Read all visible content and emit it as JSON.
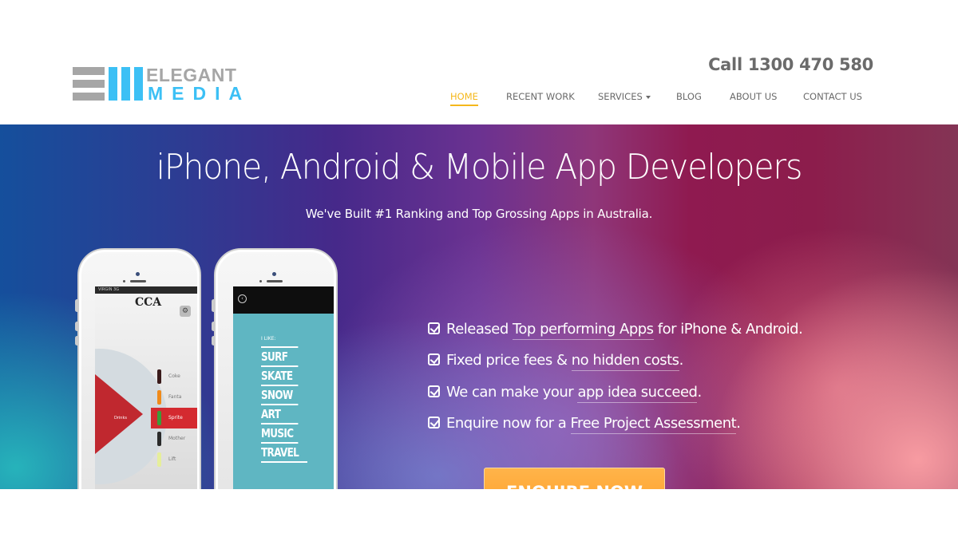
{
  "header": {
    "logo": {
      "top": "ELEGANT",
      "bottom": "MEDIA"
    },
    "phone_cta": "Call 1300 470 580",
    "nav": [
      {
        "label": "HOME",
        "active": true
      },
      {
        "label": "RECENT WORK"
      },
      {
        "label": "SERVICES",
        "has_dropdown": true
      },
      {
        "label": "BLOG"
      },
      {
        "label": "ABOUT US"
      },
      {
        "label": "CONTACT US"
      }
    ]
  },
  "hero": {
    "title": "iPhone, Android & Mobile App Developers",
    "subtitle": "We've Built #1 Ranking and Top Grossing Apps in Australia.",
    "phone1": {
      "carrier": "VIRGIN 3G",
      "logo": "CCA",
      "wedge_label": "Drinks",
      "drinks": [
        "Coke",
        "Fanta",
        "Sprite",
        "Mother",
        "Lift"
      ],
      "selected_drink": "Sprite"
    },
    "phone2": {
      "heading": "I LIKE:",
      "items": [
        "SURF",
        "SKATE",
        "SNOW",
        "ART",
        "MUSIC",
        "TRAVEL"
      ]
    },
    "features": [
      {
        "pre": "Released ",
        "link": "Top performing Apps",
        "post": " for iPhone & Android."
      },
      {
        "pre": "Fixed price fees & ",
        "link": "no hidden costs",
        "post": "."
      },
      {
        "pre": "We can make your ",
        "link": "app idea succeed",
        "post": "."
      },
      {
        "pre": "Enquire now for a ",
        "link": "Free Project Assessment",
        "post": "."
      }
    ],
    "cta_label": "ENQUIRE NOW"
  },
  "colors": {
    "accent": "#f5b81c",
    "logo_blue": "#3cc0f5",
    "logo_gray": "#a6a6a6",
    "cta_orange": "#ffa330",
    "nav_text": "#6a6a6a"
  }
}
